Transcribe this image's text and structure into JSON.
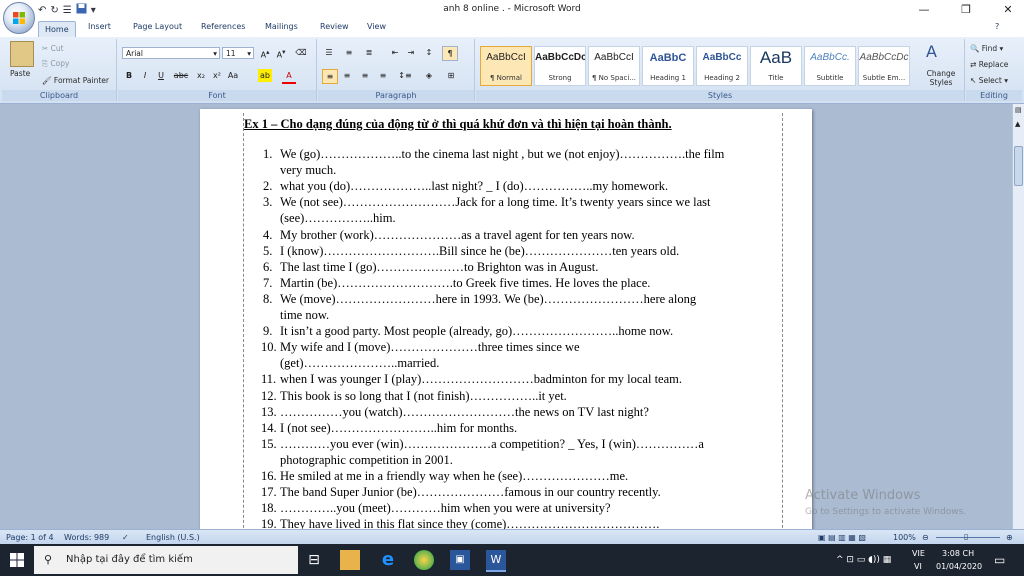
{
  "window": {
    "title": "anh 8 online . - Microsoft Word",
    "help_glyph": "?"
  },
  "tabs": [
    "Home",
    "Insert",
    "Page Layout",
    "References",
    "Mailings",
    "Review",
    "View"
  ],
  "ribbon": {
    "clipboard": {
      "paste": "Paste",
      "cut": "Cut",
      "copy": "Copy",
      "format_painter": "Format Painter",
      "label": "Clipboard"
    },
    "font": {
      "font_name": "Arial",
      "font_size": "11",
      "label": "Font"
    },
    "paragraph": {
      "label": "Paragraph"
    },
    "styles": {
      "label": "Styles",
      "items": [
        {
          "sample": "AaBbCcI",
          "name": "¶ Normal"
        },
        {
          "sample": "AaBbCcDc",
          "name": "Strong"
        },
        {
          "sample": "AaBbCcI",
          "name": "¶ No Spaci..."
        },
        {
          "sample": "AaBbC",
          "name": "Heading 1"
        },
        {
          "sample": "AaBbCc",
          "name": "Heading 2"
        },
        {
          "sample": "AaB",
          "name": "Title"
        },
        {
          "sample": "AaBbCc.",
          "name": "Subtitle"
        },
        {
          "sample": "AaBbCcDc",
          "name": "Subtle Em..."
        }
      ],
      "change_styles": "Change Styles"
    },
    "editing": {
      "find": "Find",
      "replace": "Replace",
      "select": "Select",
      "label": "Editing"
    }
  },
  "document": {
    "heading": "Ex 1 – Cho dạng đúng của động từ ở thì quá khứ đơn và thì hiện tại hoàn thành.",
    "items": [
      {
        "num": "1.",
        "lines": [
          "We (go)………………..to the cinema last night , but we (not enjoy)…………….the film",
          "very much."
        ]
      },
      {
        "num": "2.",
        "lines": [
          "what you (do)………………..last night?   _ I (do)……………..my homework."
        ]
      },
      {
        "num": "3.",
        "lines": [
          "We (not see)………………………Jack for a long time. It’s twenty years since we last",
          "(see)……………..him."
        ]
      },
      {
        "num": "4.",
        "lines": [
          "My brother (work)…………………as a travel agent for ten years now."
        ]
      },
      {
        "num": "5.",
        "lines": [
          "I (know)……………………….Bill since he (be)…………………ten years old."
        ]
      },
      {
        "num": "6.",
        "lines": [
          "The last time I (go)…………………to Brighton was in August."
        ]
      },
      {
        "num": "7.",
        "lines": [
          "Martin (be)……………………….to Greek five times. He loves the place."
        ]
      },
      {
        "num": "8.",
        "lines": [
          "We (move)……………………here in 1993. We (be)……………………here  along",
          "time now."
        ]
      },
      {
        "num": "9.",
        "lines": [
          "It isn’t a good party. Most people (already,  go)……………………..home now."
        ]
      },
      {
        "num": "10.",
        "lines": [
          "My wife and I (move)…………………three times since we",
          "(get)…………………..married."
        ]
      },
      {
        "num": "11.",
        "lines": [
          "when I was younger I (play)………………………badminton for my local team."
        ]
      },
      {
        "num": "12.",
        "lines": [
          "This book is so long that I (not finish)……………..it yet."
        ]
      },
      {
        "num": "13.",
        "lines": [
          "……………you (watch)………………………the news on TV last night?"
        ]
      },
      {
        "num": "14.",
        "lines": [
          "I (not see)……………………..him for months."
        ]
      },
      {
        "num": "15.",
        "lines": [
          "…………you ever (win)…………………a competition?  _ Yes, I (win)……………a",
          "photographic competition in 2001."
        ]
      },
      {
        "num": "16.",
        "lines": [
          "He smiled at me in a friendly way when he (see)…………………me."
        ]
      },
      {
        "num": "17.",
        "lines": [
          "The band Super Junior (be)…………………famous in our country recently."
        ]
      },
      {
        "num": "18.",
        "lines": [
          "…………..you (meet)…………him when you were at university?"
        ]
      },
      {
        "num": "19.",
        "lines": [
          "They have lived in this flat since they (come)………………………………."
        ]
      }
    ]
  },
  "statusbar": {
    "page": "Page: 1 of 4",
    "words": "Words: 989",
    "language": "English (U.S.)",
    "zoom": "100%"
  },
  "watermark": {
    "line1": "Activate Windows",
    "line2": "Go to Settings to activate Windows."
  },
  "taskbar": {
    "search_placeholder": "Nhập tại đây để tìm kiếm",
    "lang_top": "VIE",
    "lang_bottom": "VI",
    "time": "3:08 CH",
    "date": "01/04/2020"
  },
  "colors": {
    "ribbon_top": "#e8f0fa",
    "ribbon_bottom": "#d3e1f1",
    "workspace": "#aabbd2",
    "taskbar": "#1c2430"
  }
}
